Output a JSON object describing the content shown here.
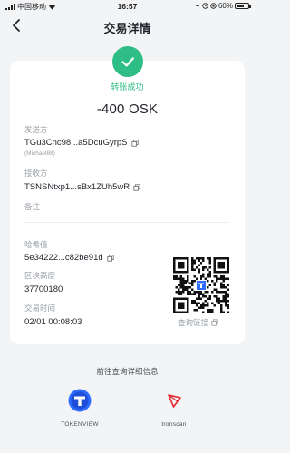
{
  "status_bar": {
    "carrier": "中国移动",
    "time": "16:57",
    "battery": "60%",
    "battery_level": 0.6
  },
  "nav": {
    "back_icon": "chevron-left-icon",
    "title": "交易详情"
  },
  "transaction": {
    "status": "转账成功",
    "amount": "-400 OSK",
    "sender_label": "发送方",
    "sender_address": "TGu3Cnc98...a5DcuGyrpS",
    "sender_name": "(Michael88)",
    "receiver_label": "接收方",
    "receiver_address": "TSNSNtxp1...sBx1ZUh5wR",
    "memo_label": "备注",
    "hash_label": "哈希值",
    "hash_value": "5e34222...c82be91d",
    "block_label": "区块高度",
    "block_value": "37700180",
    "time_label": "交易时间",
    "time_value": "02/01 00:08:03",
    "qr_link": "查询链接"
  },
  "explorers": {
    "title": "前往查询详细信息",
    "items": [
      {
        "label": "TOKENVIEW",
        "icon": "tokenview-logo"
      },
      {
        "label": "tronscan",
        "icon": "tronscan-logo"
      }
    ]
  },
  "colors": {
    "success": "#2ebd85",
    "tokenview": "#2f6bff",
    "tronscan": "#e5252b"
  }
}
